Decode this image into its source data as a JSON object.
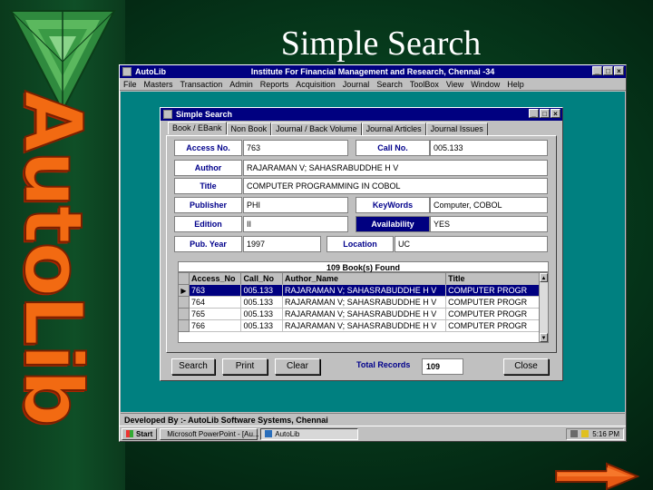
{
  "slide": {
    "title": "Simple Search",
    "side_word": "AutoLib"
  },
  "app": {
    "title": "AutoLib",
    "institute": "Institute For Financial Management and Research, Chennai -34",
    "menu": [
      "File",
      "Masters",
      "Transaction",
      "Admin",
      "Reports",
      "Acquisition",
      "Journal",
      "Search",
      "ToolBox",
      "View",
      "Window",
      "Help"
    ],
    "status": "Developed By :- AutoLib Software Systems, Chennai"
  },
  "dialog": {
    "title": "Simple Search",
    "tabs": [
      "Book / EBank",
      "Non Book",
      "Journal / Back Volume",
      "Journal Articles",
      "Journal Issues"
    ],
    "active_tab": 0,
    "fields": {
      "access_no_label": "Access No.",
      "access_no": "763",
      "call_no_label": "Call No.",
      "call_no": "005.133",
      "author_label": "Author",
      "author": "RAJARAMAN V; SAHASRABUDDHE H V",
      "title_label": "Title",
      "title": "COMPUTER PROGRAMMING IN COBOL",
      "publisher_label": "Publisher",
      "publisher": "PHI",
      "keywords_label": "KeyWords",
      "keywords": "Computer, COBOL",
      "edition_label": "Edition",
      "edition": "II",
      "availability_label": "Availability",
      "availability": "YES",
      "pub_year_label": "Pub. Year",
      "pub_year": "1997",
      "location_label": "Location",
      "location": "UC"
    },
    "grid": {
      "caption": "109 Book(s) Found",
      "columns": [
        "Access_No",
        "Call_No",
        "Author_Name",
        "Title"
      ],
      "rows": [
        [
          "763",
          "005.133",
          "RAJARAMAN V; SAHASRABUDDHE H V",
          "COMPUTER PROGR"
        ],
        [
          "764",
          "005.133",
          "RAJARAMAN V; SAHASRABUDDHE H V",
          "COMPUTER PROGR"
        ],
        [
          "765",
          "005.133",
          "RAJARAMAN V; SAHASRABUDDHE H V",
          "COMPUTER PROGR"
        ],
        [
          "766",
          "005.133",
          "RAJARAMAN V; SAHASRABUDDHE H V",
          "COMPUTER PROGR"
        ]
      ]
    },
    "buttons": {
      "search": "Search",
      "print": "Print",
      "clear": "Clear",
      "close": "Close"
    },
    "total_records_label": "Total Records",
    "total_records": "109"
  },
  "taskbar": {
    "start": "Start",
    "items": [
      "Microsoft PowerPoint - [Au...",
      "AutoLib"
    ],
    "clock": "5:16 PM"
  },
  "colors": {
    "accent_orange": "#f26a12",
    "titlebar": "#000080",
    "workspace": "#008080"
  }
}
